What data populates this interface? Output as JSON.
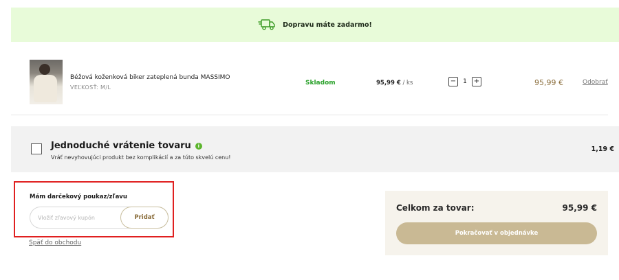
{
  "shipping_banner": {
    "text": "Dopravu máte zadarmo!",
    "icon": "truck-icon",
    "color": "#e8fbd9"
  },
  "cart_items": [
    {
      "name": "Béžová koženková biker zateplená bunda MASSIMO",
      "variant": "VEĽKOSŤ: M/L",
      "availability": "Skladom",
      "unit_price": "95,99 €",
      "unit_suffix": " / ks",
      "quantity": "1",
      "decrease_label": "−",
      "increase_label": "+",
      "line_total": "95,99 €",
      "remove_label": "Odobrať"
    }
  ],
  "easy_return": {
    "title": "Jednoduché vrátenie tovaru",
    "info_icon": "info-icon",
    "description": "Vráť nevyhovujúci produkt bez komplikácií a za túto skvelú cenu!",
    "price": "1,19 €",
    "checked": false
  },
  "coupon": {
    "title": "Mám darčekový poukaz/zľavu",
    "input_placeholder": "Vložiť zľavový kupón",
    "input_value": "",
    "button_label": "Pridať",
    "highlight_color": "#e02020"
  },
  "back_link": "Späť do obchodu",
  "summary": {
    "label": "Celkom za tovar:",
    "value": "95,99 €",
    "checkout_label": "Pokračovať v objednávke",
    "accent_color": "#c9b994"
  }
}
